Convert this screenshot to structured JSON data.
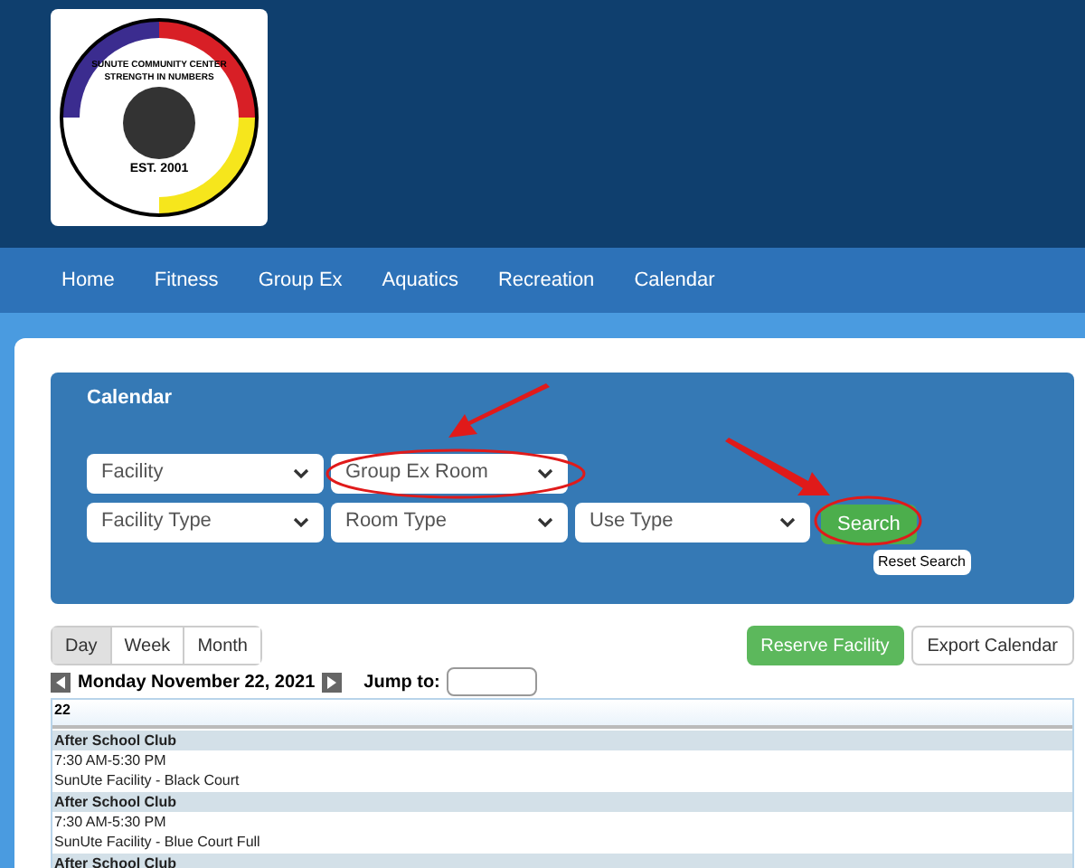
{
  "logo": {
    "lines": [
      "SUNUTE COMMUNITY CENTER",
      "STRENGTH IN NUMBERS",
      "EST. 2001"
    ]
  },
  "nav": [
    {
      "label": "Home"
    },
    {
      "label": "Fitness"
    },
    {
      "label": "Group Ex"
    },
    {
      "label": "Aquatics"
    },
    {
      "label": "Recreation"
    },
    {
      "label": "Calendar"
    }
  ],
  "panel": {
    "title": "Calendar",
    "filter_rows": [
      [
        {
          "value": "Facility",
          "highlighted": false
        },
        {
          "value": "Group Ex Room",
          "highlighted": true
        }
      ],
      [
        {
          "value": "Facility Type",
          "highlighted": false
        },
        {
          "value": "Room Type",
          "highlighted": false
        },
        {
          "value": "Use Type",
          "highlighted": false
        }
      ]
    ],
    "search_button": "Search",
    "reset_button": "Reset Search"
  },
  "views": [
    {
      "label": "Day",
      "selected": true
    },
    {
      "label": "Week",
      "selected": false
    },
    {
      "label": "Month",
      "selected": false
    }
  ],
  "actions": [
    {
      "label": "Reserve Facility",
      "kind": "primary"
    },
    {
      "label": "Export Calendar",
      "kind": "default"
    }
  ],
  "date": "Monday November 22, 2021",
  "jump_label": "Jump to:",
  "day_header": "22",
  "events": [
    {
      "title": "After School Club",
      "time": "7:30 AM-5:30 PM",
      "location": "SunUte Facility - Black Court"
    },
    {
      "title": "After School Club",
      "time": "7:30 AM-5:30 PM",
      "location": "SunUte Facility - Blue Court Full"
    },
    {
      "title": "After School Club"
    }
  ]
}
